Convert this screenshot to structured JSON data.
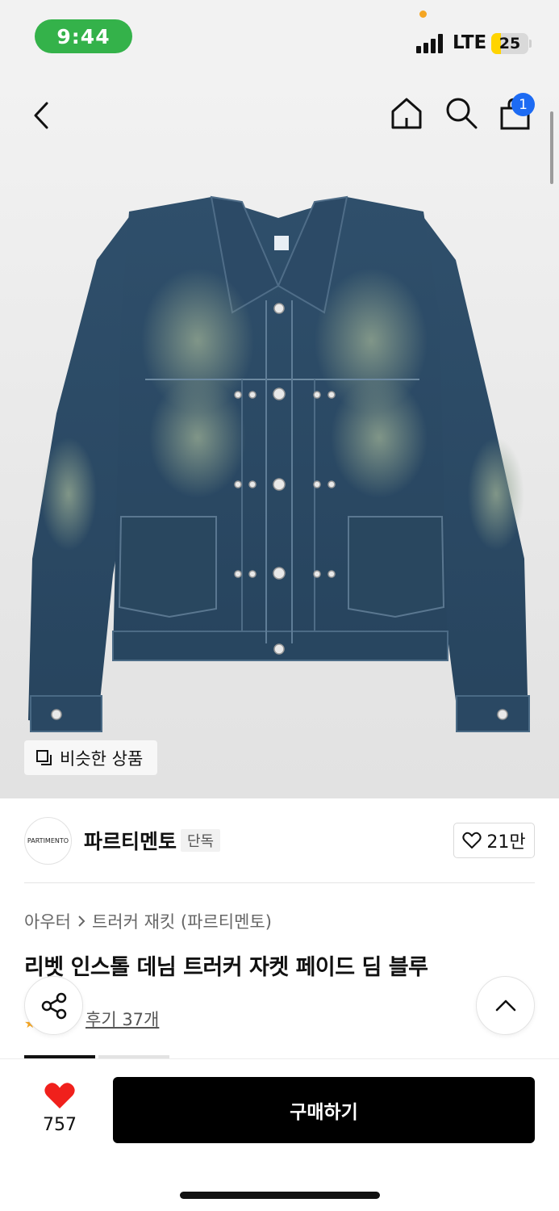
{
  "status_bar": {
    "time": "9:44",
    "network": "LTE",
    "battery": "25",
    "battery_level": 0.25
  },
  "nav": {
    "back_icon": "chevron-left-icon",
    "home_icon": "home-icon",
    "search_icon": "search-icon",
    "cart_icon": "shopping-bag-icon",
    "cart_badge": "1"
  },
  "image": {
    "subject": "denim-jacket",
    "similar_button_label": "비슷한 상품"
  },
  "brand": {
    "logo_text": "PARTIMENTO",
    "name": "파르티멘토",
    "tag": "단독",
    "likes": "21만"
  },
  "breadcrumb": {
    "category": "아우터",
    "subcategory": "트러커 재킷 (파르티멘토)"
  },
  "product": {
    "title": "리벳 인스톨 데님 트러커 자켓 페이드 딤 블루",
    "review_label": "후기 37개"
  },
  "bottom_bar": {
    "wish_count": "757",
    "buy_label": "구매하기"
  },
  "colors": {
    "accent_red": "#f0201c",
    "badge_blue": "#1d6bf3",
    "time_green": "#34b24a",
    "battery_yellow": "#ffd400"
  }
}
